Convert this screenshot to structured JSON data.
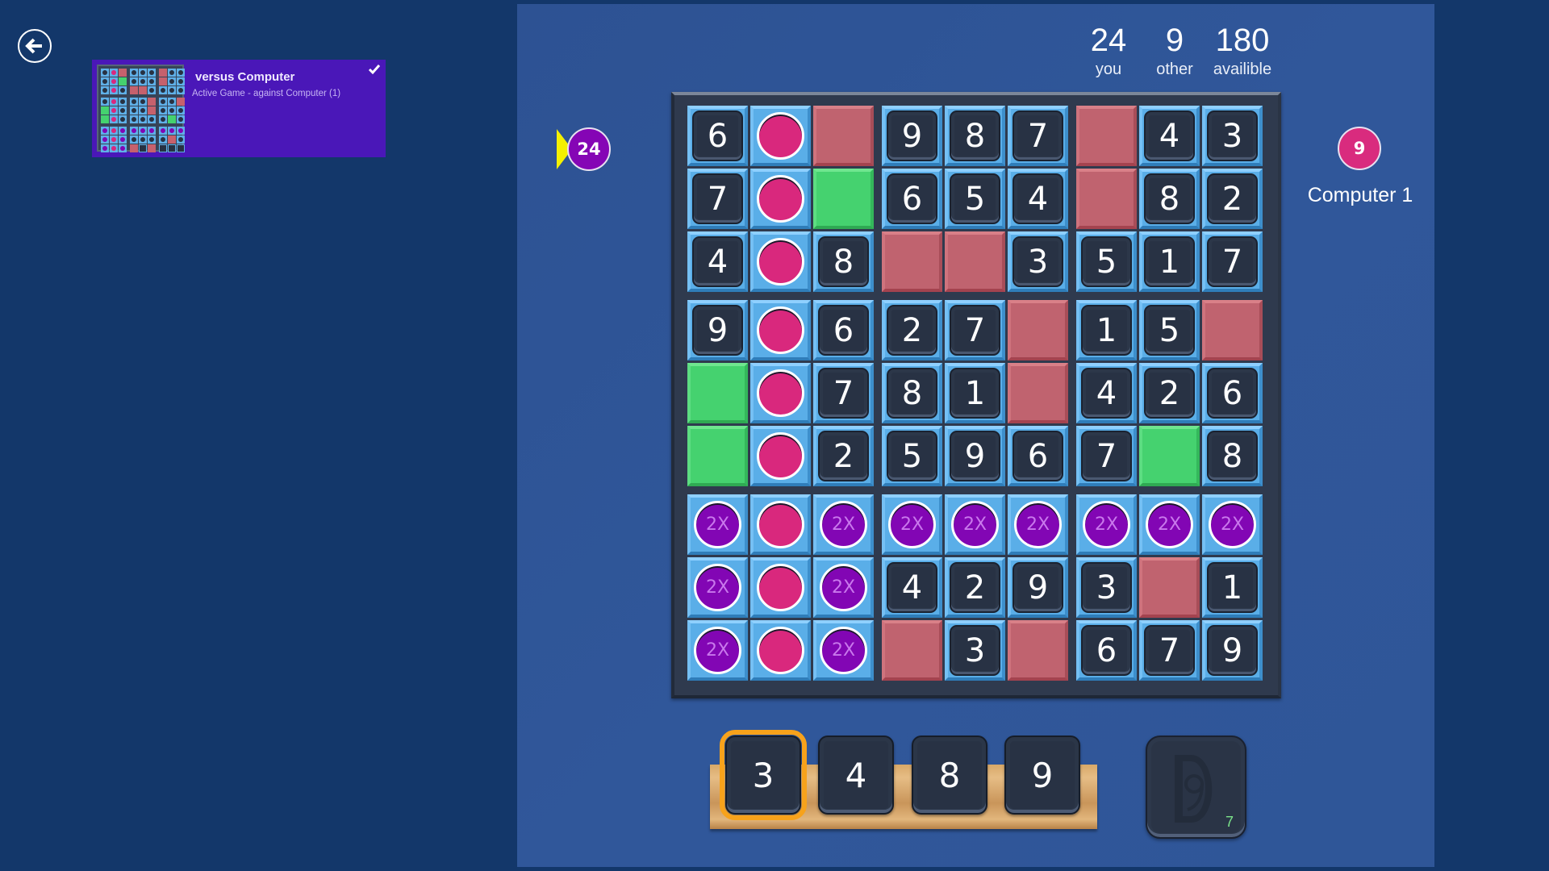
{
  "nav": {
    "back_icon": "arrow-left-circle-icon"
  },
  "game_card": {
    "title": "versus Computer",
    "subtitle": "Active Game -  against Computer (1)",
    "selected_icon": "checkmark-icon",
    "thumbnail_grid": [
      [
        "n",
        "p",
        "r",
        "n",
        "n",
        "n",
        "r",
        "n",
        "n"
      ],
      [
        "n",
        "p",
        "g",
        "n",
        "n",
        "n",
        "r",
        "n",
        "n"
      ],
      [
        "n",
        "p",
        "n",
        "r",
        "r",
        "n",
        "n",
        "n",
        "n"
      ],
      [
        "n",
        "p",
        "n",
        "n",
        "n",
        "r",
        "n",
        "n",
        "r"
      ],
      [
        "g",
        "p",
        "n",
        "n",
        "n",
        "r",
        "n",
        "n",
        "n"
      ],
      [
        "g",
        "p",
        "n",
        "n",
        "n",
        "n",
        "n",
        "g",
        "n"
      ],
      [
        "v",
        "p",
        "v",
        "v",
        "v",
        "v",
        "v",
        "v",
        "v"
      ],
      [
        "v",
        "p",
        "v",
        "n",
        "n",
        "n",
        "n",
        "r",
        "n"
      ],
      [
        "v",
        "p",
        "v",
        "r",
        "e",
        "r",
        "e",
        "e",
        "e"
      ]
    ]
  },
  "stats": [
    {
      "value": "24",
      "label": "you"
    },
    {
      "value": "9",
      "label": "other"
    },
    {
      "value": "180",
      "label": "availible"
    }
  ],
  "players": {
    "you": {
      "score": "24",
      "color": "#8505b5",
      "turn_indicator": true
    },
    "opponent": {
      "score": "9",
      "name": "Computer 1",
      "color": "#d92b7e"
    }
  },
  "board": {
    "legend": {
      "num": "number tile",
      "pink": "opponent chip",
      "bonus": "2X bonus chip",
      "red": "blocked cell",
      "green": "open green cell"
    },
    "bonus_label": "2X",
    "rows": [
      [
        "6",
        "pink",
        "red",
        "9",
        "8",
        "7",
        "red",
        "4",
        "3"
      ],
      [
        "7",
        "pink",
        "green",
        "6",
        "5",
        "4",
        "red",
        "8",
        "2"
      ],
      [
        "4",
        "pink",
        "8",
        "red",
        "red",
        "3",
        "5",
        "1",
        "7"
      ],
      [
        "9",
        "pink",
        "6",
        "2",
        "7",
        "red",
        "1",
        "5",
        "red"
      ],
      [
        "green",
        "pink",
        "7",
        "8",
        "1",
        "red",
        "4",
        "2",
        "6"
      ],
      [
        "green",
        "pink",
        "2",
        "5",
        "9",
        "6",
        "7",
        "green",
        "8"
      ],
      [
        "bonus",
        "pink",
        "bonus",
        "bonus",
        "bonus",
        "bonus",
        "bonus",
        "bonus",
        "bonus"
      ],
      [
        "bonus",
        "pink",
        "bonus",
        "4",
        "2",
        "9",
        "3",
        "red",
        "1"
      ],
      [
        "bonus",
        "pink",
        "bonus",
        "red",
        "3",
        "red",
        "6",
        "7",
        "9"
      ]
    ]
  },
  "rack": {
    "tiles": [
      "3",
      "4",
      "8",
      "9"
    ],
    "selected_index": 0
  },
  "draw_pile": {
    "logo": "D9",
    "remaining": "7"
  },
  "colors": {
    "background": "#13376a",
    "panel": "#2f5696",
    "card": "#4a17b8",
    "selected_outline": "#f7a21b",
    "pile_count": "#7be38a"
  }
}
